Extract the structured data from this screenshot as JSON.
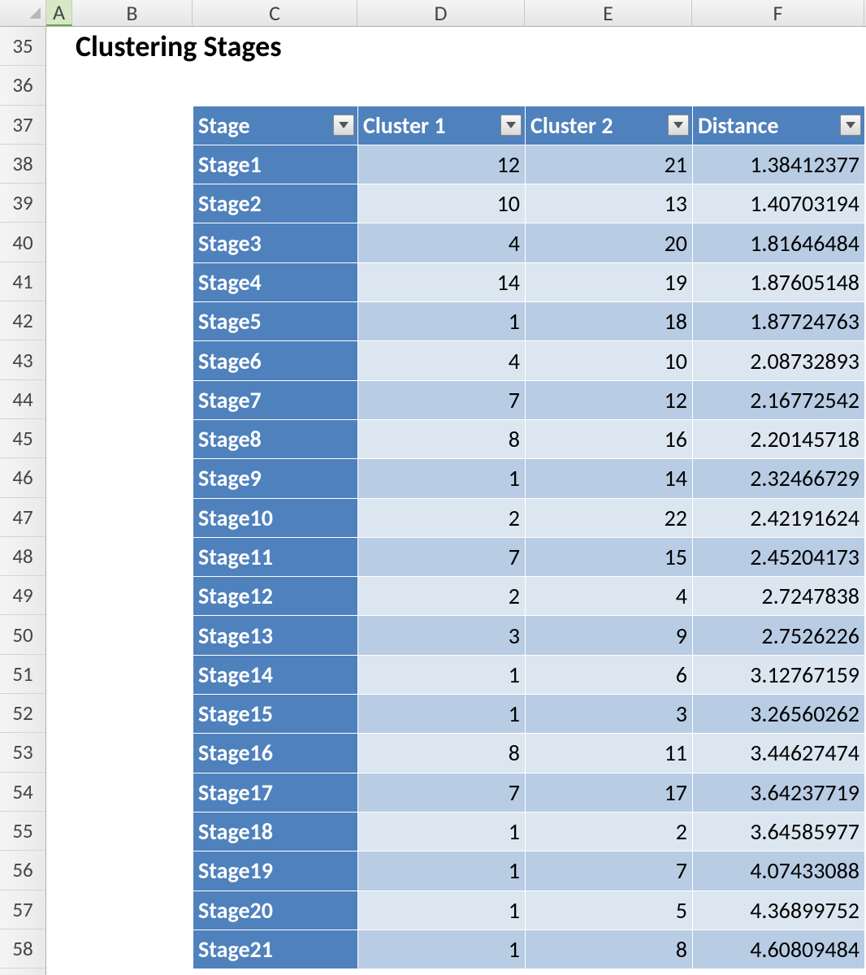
{
  "columns": [
    "A",
    "B",
    "C",
    "D",
    "E",
    "F"
  ],
  "row_numbers": [
    "35",
    "36",
    "37",
    "38",
    "39",
    "40",
    "41",
    "42",
    "43",
    "44",
    "45",
    "46",
    "47",
    "48",
    "49",
    "50",
    "51",
    "52",
    "53",
    "54",
    "55",
    "56",
    "57",
    "58"
  ],
  "title": "Clustering Stages",
  "table": {
    "headers": [
      "Stage",
      "Cluster 1",
      "Cluster 2",
      "Distance"
    ],
    "rows": [
      {
        "stage": "Stage1",
        "c1": "12",
        "c2": "21",
        "d": "1.38412377"
      },
      {
        "stage": "Stage2",
        "c1": "10",
        "c2": "13",
        "d": "1.40703194"
      },
      {
        "stage": "Stage3",
        "c1": "4",
        "c2": "20",
        "d": "1.81646484"
      },
      {
        "stage": "Stage4",
        "c1": "14",
        "c2": "19",
        "d": "1.87605148"
      },
      {
        "stage": "Stage5",
        "c1": "1",
        "c2": "18",
        "d": "1.87724763"
      },
      {
        "stage": "Stage6",
        "c1": "4",
        "c2": "10",
        "d": "2.08732893"
      },
      {
        "stage": "Stage7",
        "c1": "7",
        "c2": "12",
        "d": "2.16772542"
      },
      {
        "stage": "Stage8",
        "c1": "8",
        "c2": "16",
        "d": "2.20145718"
      },
      {
        "stage": "Stage9",
        "c1": "1",
        "c2": "14",
        "d": "2.32466729"
      },
      {
        "stage": "Stage10",
        "c1": "2",
        "c2": "22",
        "d": "2.42191624"
      },
      {
        "stage": "Stage11",
        "c1": "7",
        "c2": "15",
        "d": "2.45204173"
      },
      {
        "stage": "Stage12",
        "c1": "2",
        "c2": "4",
        "d": "2.7247838"
      },
      {
        "stage": "Stage13",
        "c1": "3",
        "c2": "9",
        "d": "2.7526226"
      },
      {
        "stage": "Stage14",
        "c1": "1",
        "c2": "6",
        "d": "3.12767159"
      },
      {
        "stage": "Stage15",
        "c1": "1",
        "c2": "3",
        "d": "3.26560262"
      },
      {
        "stage": "Stage16",
        "c1": "8",
        "c2": "11",
        "d": "3.44627474"
      },
      {
        "stage": "Stage17",
        "c1": "7",
        "c2": "17",
        "d": "3.64237719"
      },
      {
        "stage": "Stage18",
        "c1": "1",
        "c2": "2",
        "d": "3.64585977"
      },
      {
        "stage": "Stage19",
        "c1": "1",
        "c2": "7",
        "d": "4.07433088"
      },
      {
        "stage": "Stage20",
        "c1": "1",
        "c2": "5",
        "d": "4.36899752"
      },
      {
        "stage": "Stage21",
        "c1": "1",
        "c2": "8",
        "d": "4.60809484"
      }
    ]
  }
}
